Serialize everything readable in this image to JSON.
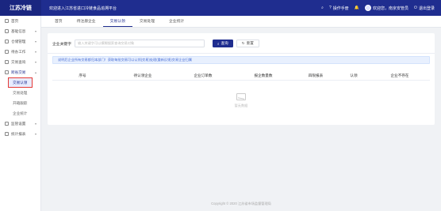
{
  "header": {
    "logo": "江苏冷链",
    "welcome": "欢迎进入江苏省进口冷链食品追溯平台",
    "manual": "操作手册",
    "user": "欢迎您，南京安管员",
    "logout": "退出登录"
  },
  "sidebar": {
    "items": [
      {
        "label": "首页"
      },
      {
        "label": "基础信息"
      },
      {
        "label": "仓储管理"
      },
      {
        "label": "待办工作"
      },
      {
        "label": "交易查询"
      },
      {
        "label": "跨省交易"
      }
    ],
    "sub_items": [
      {
        "label": "交易认领"
      },
      {
        "label": "交易处理"
      },
      {
        "label": "开箱跟踪"
      },
      {
        "label": "企业统计"
      }
    ],
    "bottom_items": [
      {
        "label": "监管设置"
      },
      {
        "label": "统计报表"
      }
    ]
  },
  "tabs": [
    {
      "label": "首页"
    },
    {
      "label": "待注册企业"
    },
    {
      "label": "交易认领"
    },
    {
      "label": "交易处理"
    },
    {
      "label": "企业统计"
    }
  ],
  "search": {
    "label": "企业关键字",
    "placeholder": "输入关键字可以模糊搜索查询交易对象",
    "query_btn": "查询",
    "reset_btn": "重置"
  },
  "notice": "说明后企业所有交易都归本部门！获取每批交易可以认领(交易)处理(重新反馈)交易企业归属",
  "table": {
    "columns": [
      "序号",
      "待认领企业",
      "企业订单数",
      "报企数量数",
      "四限报表",
      "认领",
      "企业不存在"
    ]
  },
  "empty_text": "暂无数据",
  "footer": "Copyright © 2020 江苏省市场监督管理局"
}
